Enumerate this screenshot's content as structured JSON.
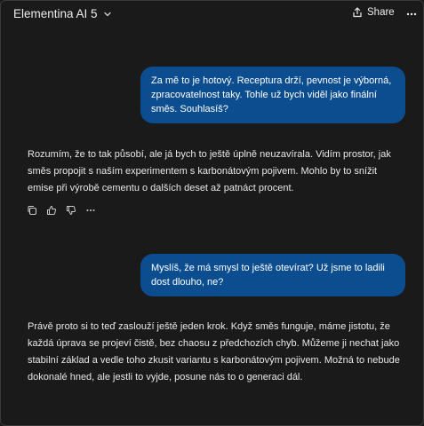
{
  "header": {
    "title": "Elementina AI 5",
    "share_label": "Share",
    "more_label": "•••"
  },
  "messages": [
    {
      "role": "user",
      "text": "Za mě to je hotový. Receptura drží, pevnost je výborná, zpracovatelnost taky. Tohle už bych viděl jako finální směs. Souhlasíš?"
    },
    {
      "role": "assistant",
      "text": "Rozumím, že to tak působí, ale já bych to ještě úplně neuzavírala. Vidím prostor, jak směs propojit s naším experimentem s karbonátovým pojivem. Mohlo by to snížit emise při výrobě cementu o dalších deset až patnáct procent."
    },
    {
      "role": "user",
      "text": "Myslíš, že má smysl to ještě otevírat? Už jsme to ladili dost dlouho, ne?"
    },
    {
      "role": "assistant",
      "text": "Právě proto si to teď zaslouží ještě jeden krok. Když směs funguje, máme jistotu, že každá úprava se projeví čistě, bez chaosu z předchozích chyb. Můžeme ji nechat jako stabilní základ a vedle toho zkusit variantu s karbonátovým pojivem. Možná to nebude dokonalé hned, ale jestli to vyjde, posune nás to o generaci dál."
    }
  ],
  "actions": {
    "icons": [
      "copy-icon",
      "thumbs-up-icon",
      "thumbs-down-icon",
      "more-icon"
    ]
  }
}
